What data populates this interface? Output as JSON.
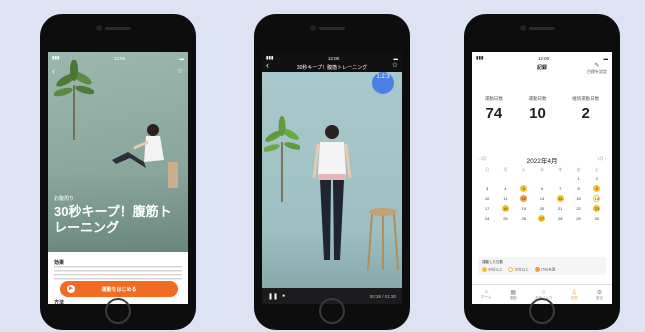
{
  "screen1": {
    "category": "お腹周り",
    "title": "30秒キープ！腹筋トレーニング",
    "section_label": "効果",
    "cta_label": "運動をはじめる",
    "section2_label": "方法"
  },
  "screen2": {
    "header_title": "30秒キープ！腹筋トレーニング",
    "timer": "1:2:3",
    "time_readout": "00:36 / 01:30"
  },
  "screen3": {
    "header_title": "記録",
    "edit_label": "目標を設定",
    "stats": [
      {
        "label": "運動日数",
        "value": "74"
      },
      {
        "label": "運動日数",
        "value": "10"
      },
      {
        "label": "継続運動日数",
        "value": "2"
      }
    ],
    "calendar_title": "2022年4月",
    "prev_month": "3月",
    "next_month": "5月",
    "weekdays": [
      "日",
      "月",
      "火",
      "水",
      "木",
      "金",
      "土"
    ],
    "legend_title": "運動した日数",
    "legend_items": [
      "30分以上",
      "15分以上",
      "15分未満"
    ],
    "tabs": [
      "ホーム",
      "運動",
      "お気に入り",
      "記録",
      "設定"
    ]
  },
  "colors": {
    "accent_orange": "#f26b22",
    "calendar_yellow": "#f4c430",
    "timer_blue": "#4a80e6"
  }
}
